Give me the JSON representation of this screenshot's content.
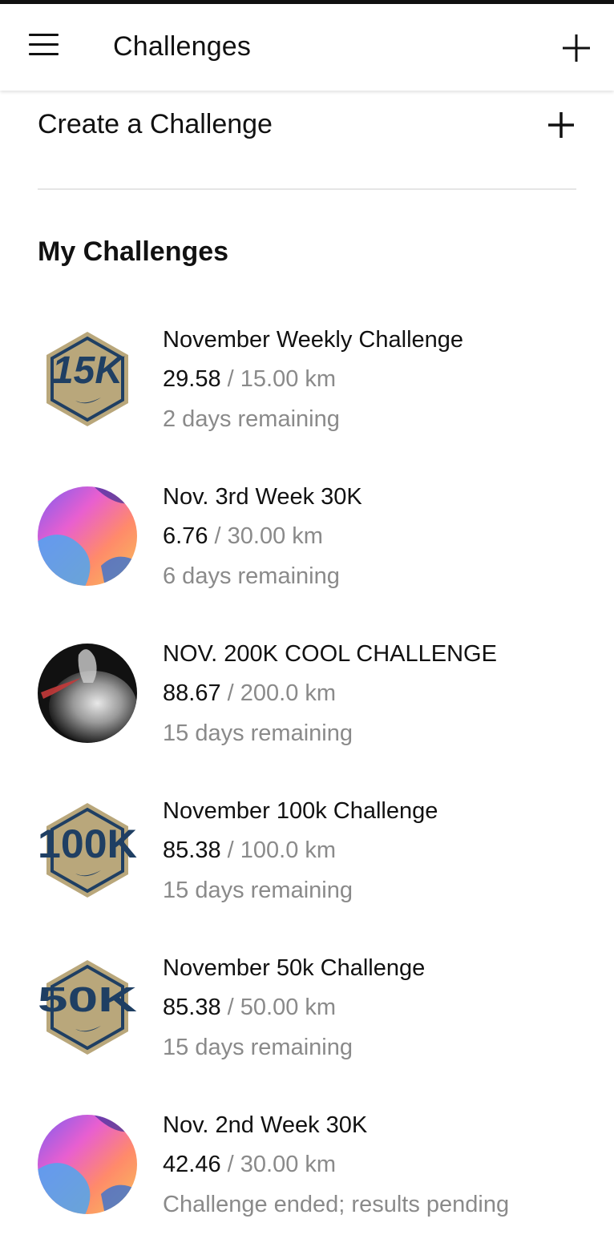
{
  "header": {
    "title": "Challenges",
    "menu_icon": "hamburger-menu-icon",
    "add_icon": "plus-icon"
  },
  "create": {
    "label": "Create a Challenge",
    "icon": "plus-icon"
  },
  "my_challenges": {
    "title": "My Challenges",
    "items": [
      {
        "title": "November Weekly Challenge",
        "current": "29.58",
        "separator": " / ",
        "goal": "15.00 km",
        "status": "2 days remaining",
        "badge": "15k-hex-badge-icon",
        "badge_text": "15K"
      },
      {
        "title": "Nov. 3rd Week 30K",
        "current": "6.76",
        "separator": " / ",
        "goal": "30.00 km",
        "status": "6 days remaining",
        "badge": "gradient-circle-badge-icon"
      },
      {
        "title": "NOV. 200K COOL CHALLENGE",
        "current": "88.67",
        "separator": " / ",
        "goal": "200.0 km",
        "status": "15 days remaining",
        "badge": "smoke-circle-badge-icon"
      },
      {
        "title": "November 100k Challenge",
        "current": "85.38",
        "separator": " / ",
        "goal": "100.0 km",
        "status": "15 days remaining",
        "badge": "100k-hex-badge-icon",
        "badge_text": "100K"
      },
      {
        "title": "November 50k Challenge",
        "current": "85.38",
        "separator": " / ",
        "goal": "50.00 km",
        "status": "15 days remaining",
        "badge": "50k-hex-badge-icon",
        "badge_text": "50K"
      },
      {
        "title": "Nov. 2nd Week 30K",
        "current": "42.46",
        "separator": " / ",
        "goal": "30.00 km",
        "status": "Challenge ended; results pending",
        "badge": "gradient-circle-badge-icon"
      }
    ]
  },
  "colors": {
    "text_primary": "#111111",
    "text_secondary": "#8a8a8a",
    "badge_gold": "#b9a77b",
    "badge_navy": "#1f3f63",
    "divider": "#e5e5e5"
  }
}
